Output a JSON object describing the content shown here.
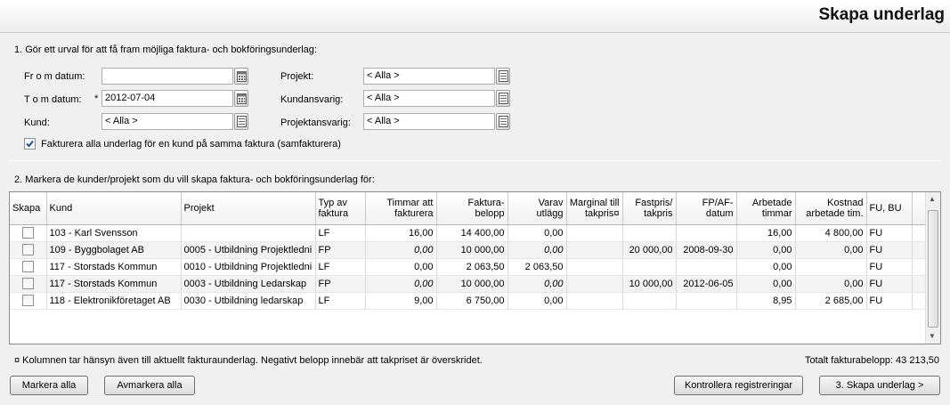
{
  "header": {
    "title": "Skapa underlag"
  },
  "section1": {
    "label": "1. Gör ett urval för att få fram möjliga faktura- och bokföringsunderlag:",
    "from_label": "Fr o m datum:",
    "from_value": "",
    "tom_label": "T o m datum:",
    "tom_required": "*",
    "tom_value": "2012-07-04",
    "kund_label": "Kund:",
    "kund_value": "< Alla >",
    "projekt_label": "Projekt:",
    "projekt_value": "< Alla >",
    "kundansvarig_label": "Kundansvarig:",
    "kundansvarig_value": "< Alla >",
    "projektansvarig_label": "Projektansvarig:",
    "projektansvarig_value": "< Alla >",
    "samfakturera_label": "Fakturera alla underlag för en kund på samma faktura (samfakturera)",
    "samfakturera_checked": true
  },
  "section2": {
    "label": "2. Markera de kunder/projekt som du vill skapa faktura- och bokföringsunderlag för:"
  },
  "table": {
    "headers": {
      "skapa": "Skapa",
      "kund": "Kund",
      "projekt": "Projekt",
      "typ": "Typ av faktura",
      "timmar": "Timmar att fakturera",
      "belopp": "Faktura-belopp",
      "utlagg": "Varav utlägg",
      "marginal": "Marginal till takpris¤",
      "fastpris": "Fastpris/ takpris",
      "datum": "FP/AF-datum",
      "arbtim": "Arbetade timmar",
      "kostnad": "Kostnad arbetade tim.",
      "fubu": "FU, BU"
    },
    "rows": [
      {
        "kund": "103 - Karl Svensson",
        "projekt": "",
        "typ": "LF",
        "timmar": "16,00",
        "belopp": "14 400,00",
        "utlagg": "0,00",
        "marginal": "",
        "fastpris": "",
        "datum": "",
        "arbtim": "16,00",
        "kostnad": "4 800,00",
        "fubu": "FU"
      },
      {
        "kund": "109 - Byggbolaget AB",
        "projekt": "0005 - Utbildning Projektledni",
        "typ": "FP",
        "timmar": "0,00",
        "belopp": "10 000,00",
        "utlagg": "0,00",
        "marginal": "",
        "fastpris": "20 000,00",
        "datum": "2008-09-30",
        "arbtim": "0,00",
        "kostnad": "0,00",
        "fubu": "FU"
      },
      {
        "kund": "117 - Storstads Kommun",
        "projekt": "0010 - Utbildning Projektledni",
        "typ": "LF",
        "timmar": "0,00",
        "belopp": "2 063,50",
        "utlagg": "2 063,50",
        "marginal": "",
        "fastpris": "",
        "datum": "",
        "arbtim": "0,00",
        "kostnad": "",
        "fubu": "FU"
      },
      {
        "kund": "117 - Storstads Kommun",
        "projekt": "0003 - Utbildning Ledarskap",
        "typ": "FP",
        "timmar": "0,00",
        "belopp": "10 000,00",
        "utlagg": "0,00",
        "marginal": "",
        "fastpris": "10 000,00",
        "datum": "2012-06-05",
        "arbtim": "0,00",
        "kostnad": "0,00",
        "fubu": "FU"
      },
      {
        "kund": "118 - Elektronikföretaget AB",
        "projekt": "0030 - Utbildning ledarskap",
        "typ": "LF",
        "timmar": "9,00",
        "belopp": "6 750,00",
        "utlagg": "0,00",
        "marginal": "",
        "fastpris": "",
        "datum": "",
        "arbtim": "8,95",
        "kostnad": "2 685,00",
        "fubu": "FU"
      }
    ]
  },
  "footnote": "¤ Kolumnen tar hänsyn även till aktuellt fakturaunderlag. Negativt belopp innebär att takpriset är överskridet.",
  "total": "Totalt fakturabelopp: 43 213,50",
  "buttons": {
    "markera_alla": "Markera alla",
    "avmarkera_alla": "Avmarkera alla",
    "kontrollera": "Kontrollera registreringar",
    "skapa": "3. Skapa underlag >"
  },
  "icons": {
    "picker": "list-picker-icon",
    "calendar": "calendar-icon",
    "checkmark": "checkmark-icon"
  },
  "colors": {
    "check": "#1c4f9c",
    "header_bg": "#ffffff",
    "panel_bg": "#f0f0f0"
  }
}
